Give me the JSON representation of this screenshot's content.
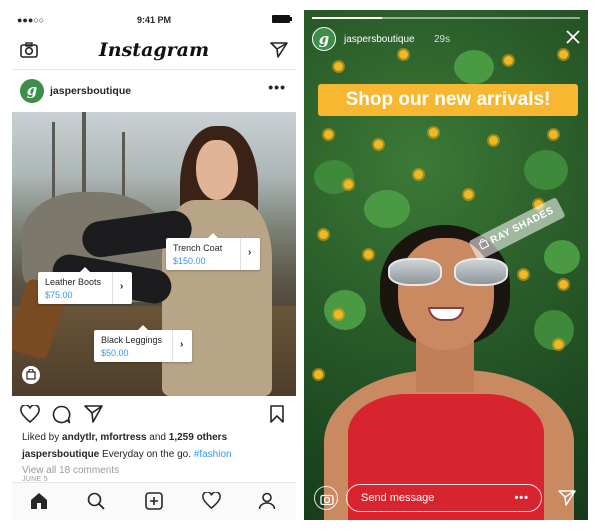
{
  "feed": {
    "status_time": "9:41 PM",
    "signal_text": "●●●○○",
    "app_title": "Instagram",
    "post_username": "jaspersboutique",
    "avatar_letter": "g",
    "more_label": "•••",
    "tags": [
      {
        "name": "Trench Coat",
        "price": "$150.00"
      },
      {
        "name": "Leather Boots",
        "price": "$75.00"
      },
      {
        "name": "Black Leggings",
        "price": "$50.00"
      }
    ],
    "likes_prefix": "Liked by ",
    "likes_users": "andytlr, mfortress",
    "likes_mid": " and ",
    "likes_count": "1,259 others",
    "caption_user": "jaspersboutique",
    "caption_text": " Everyday on the go. ",
    "caption_hashtag": "#fashion",
    "comments_link": "View all 18 comments",
    "post_date": "JUNE 5"
  },
  "story": {
    "username": "jaspersboutique",
    "age": "29s",
    "avatar_letter": "g",
    "banner": "Shop our new arrivals!",
    "sticker": "RAY SHADES",
    "sticker_icon": "shopping-bag-icon",
    "message_placeholder": "Send message",
    "message_more": "•••",
    "progress": 0.26
  },
  "colors": {
    "link_blue": "#3897f0",
    "banner_yellow": "#f7b731",
    "brand_green": "#3e8e4a"
  }
}
